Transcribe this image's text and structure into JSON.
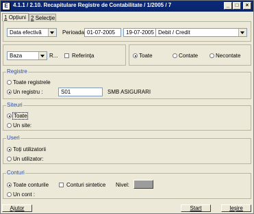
{
  "window": {
    "title": "4.1.1 / 2.10. Recapitulare Registre de Contabilitate / 1/2005 / 7",
    "icon_letter": "E",
    "minimize": "_",
    "maximize": "□",
    "close": "×"
  },
  "tabs": [
    {
      "num": "1",
      "label": "Opțiuni"
    },
    {
      "num": "2",
      "label": "Selecție"
    }
  ],
  "filters": {
    "date_type": "Data efectivă",
    "period_label": "Perioada:",
    "date_from": "01-07-2005",
    "date_to": "19-07-2005",
    "debit_credit": "Debit / Credit",
    "base": "Baza",
    "r_label": "R...",
    "reference_label": "Referința",
    "status_options": [
      "Toate",
      "Contate",
      "Necontate"
    ]
  },
  "registre": {
    "title": "Registre",
    "all_label": "Toate registrele",
    "one_label": "Un registru :",
    "code": "S01",
    "name": "SMB ASIGURARI"
  },
  "siteuri": {
    "title": "Siteuri",
    "all_label": "Toate",
    "one_label": "Un site:"
  },
  "useri": {
    "title": "Useri",
    "all_label": "Toți utilizatorii",
    "one_label": "Un utilizator:"
  },
  "conturi": {
    "title": "Conturi",
    "all_label": "Toate conturile",
    "synthetic_label": "Conturi sintetice",
    "level_label": "Nivel:",
    "one_label": "Un cont :"
  },
  "footer": {
    "help": "Ajutor",
    "start": "Start",
    "exit": "Ieșire"
  }
}
